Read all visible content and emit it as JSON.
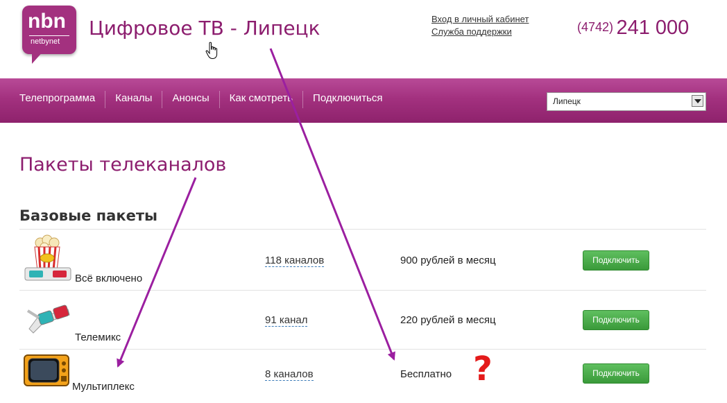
{
  "header": {
    "logo": {
      "main": "nbn",
      "sub": "netbynet"
    },
    "site_title": "Цифровое ТВ - Липецк",
    "links": [
      "Вход в личный кабинет",
      "Служба поддержки"
    ],
    "phone_code": "(4742)",
    "phone_number": "241 000"
  },
  "nav": {
    "items": [
      "Телепрограмма",
      "Каналы",
      "Анонсы",
      "Как смотреть",
      "Подключиться"
    ],
    "city_select": "Липецк"
  },
  "main": {
    "page_heading": "Пакеты телеканалов",
    "section_heading": "Базовые пакеты",
    "packages": [
      {
        "name": "Всё включено",
        "channels": "118 каналов",
        "price": "900 рублей в месяц",
        "button": "Подключить",
        "icon": "popcorn-3d-glasses-icon"
      },
      {
        "name": "Телемикс",
        "channels": "91 канал",
        "price": "220 рублей в месяц",
        "button": "Подключить",
        "icon": "3d-glasses-icon"
      },
      {
        "name": "Мультиплекс",
        "channels": "8 каналов",
        "price": "Бесплатно",
        "button": "Подключить",
        "icon": "retro-tv-icon"
      }
    ]
  },
  "annotations": {
    "question_mark": "?",
    "arrow_color": "#9b1fa0"
  },
  "colors": {
    "brand": "#a3317f",
    "title": "#8c1d6e",
    "button": "#4caf4c"
  }
}
